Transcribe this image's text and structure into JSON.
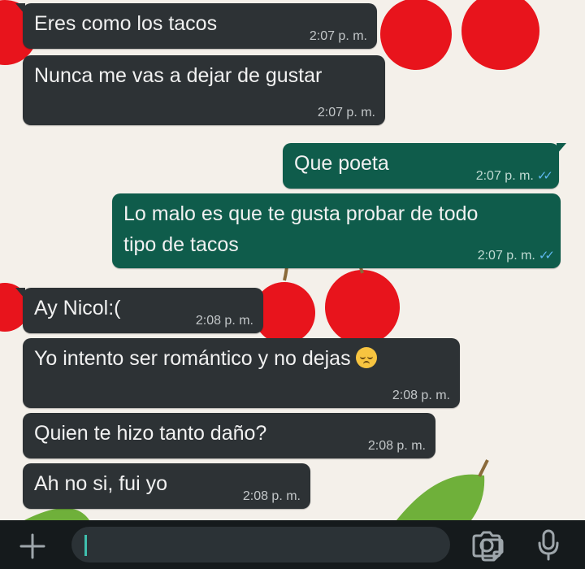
{
  "chat": {
    "messages": [
      {
        "text": "Eres como los tacos",
        "time": "2:07 p. m."
      },
      {
        "text": "Nunca me vas a dejar de gustar",
        "time": "2:07 p. m."
      },
      {
        "text": "Que poeta",
        "time": "2:07 p. m."
      },
      {
        "text_line1": "Lo malo es que te gusta probar de todo",
        "text_line2": "tipo de tacos",
        "time": "2:07 p. m."
      },
      {
        "text": "Ay Nicol:(",
        "time": "2:08 p. m."
      },
      {
        "text": "Yo intento ser romántico y no dejas",
        "emoji": "pensive-face-emoji",
        "time": "2:08 p. m."
      },
      {
        "text": "Quien te hizo tanto daño?",
        "time": "2:08 p. m."
      },
      {
        "text": "Ah no si, fui yo",
        "time": "2:08 p. m."
      }
    ],
    "read_receipt": "✓✓"
  },
  "input_bar": {
    "message_value": "",
    "icons": [
      "plus-icon",
      "sticker-icon",
      "camera-icon",
      "microphone-icon"
    ]
  },
  "colors": {
    "incoming_bubble": "#2d3235",
    "outgoing_bubble": "#0f5c4b",
    "wallpaper": "#f4f0ea",
    "input_bar": "#151a1c",
    "accent": "#3fbfae",
    "read_ticks": "#5fb8f0"
  }
}
